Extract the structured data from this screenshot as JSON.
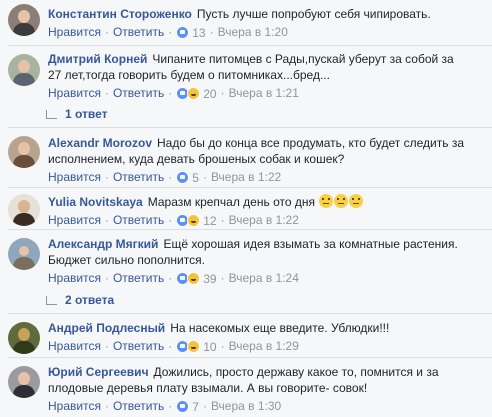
{
  "comments": [
    {
      "author": "Константин Стороженко",
      "text": "Пусть лучше попробуют себя чипировать.",
      "like": "Нравится",
      "reply": "Ответить",
      "reactions": "13",
      "time": "Вчера в 1:20",
      "avatar_icon": "photo-avatar-icon"
    },
    {
      "author": "Дмитрий Корней",
      "text_line1": "Чипаните питомцев с Рады,пускай уберут за собой за",
      "text_line2": "27 лет,тогда говорить будем о питомниках...бред...",
      "like": "Нравится",
      "reply": "Ответить",
      "reactions": "20",
      "time": "Вчера в 1:21",
      "replies": "1 ответ",
      "avatar_icon": "photo-avatar-icon"
    },
    {
      "author": "Alexandr Morozov",
      "text_line1": "Надо бы до конца все продумать, кто будет следить за",
      "text_line2": "исполнением, куда девать брошеных собак и кошек?",
      "like": "Нравится",
      "reply": "Ответить",
      "reactions": "5",
      "time": "Вчера в 1:22",
      "avatar_icon": "photo-avatar-icon"
    },
    {
      "author": "Yulia Novitskaya",
      "text": "Маразм крепчал день ото дня",
      "like": "Нравится",
      "reply": "Ответить",
      "reactions": "12",
      "time": "Вчера в 1:22",
      "avatar_icon": "photo-avatar-icon"
    },
    {
      "author": "Александр Мягкий",
      "text_line1": "Ещё хорошая идея взымать за комнатные растения.",
      "text_line2": "Бюджет сильно пополнится.",
      "like": "Нравится",
      "reply": "Ответить",
      "reactions": "39",
      "time": "Вчера в 1:24",
      "replies": "2 ответа",
      "avatar_icon": "photo-avatar-icon"
    },
    {
      "author": "Андрей Подлесный",
      "text": "На насекомых еще введите. Ублюдки!!!",
      "like": "Нравится",
      "reply": "Ответить",
      "reactions": "10",
      "time": "Вчера в 1:29",
      "avatar_icon": "photo-avatar-icon"
    },
    {
      "author": "Юрий Сергеевич",
      "text_line1": "Дожились, просто державу какое то, помнится и за",
      "text_line2": "плодовые деревья плату взымали. А вы говорите- совок!",
      "like": "Нравится",
      "reply": "Ответить",
      "reactions": "7",
      "time": "Вчера в 1:30",
      "avatar_icon": "photo-avatar-icon"
    }
  ],
  "colors": {
    "background": "#f6f7f9",
    "link": "#365899",
    "meta": "#90949c",
    "like_reaction": "#5890ff",
    "emoji_reaction": "#f5c33b"
  }
}
